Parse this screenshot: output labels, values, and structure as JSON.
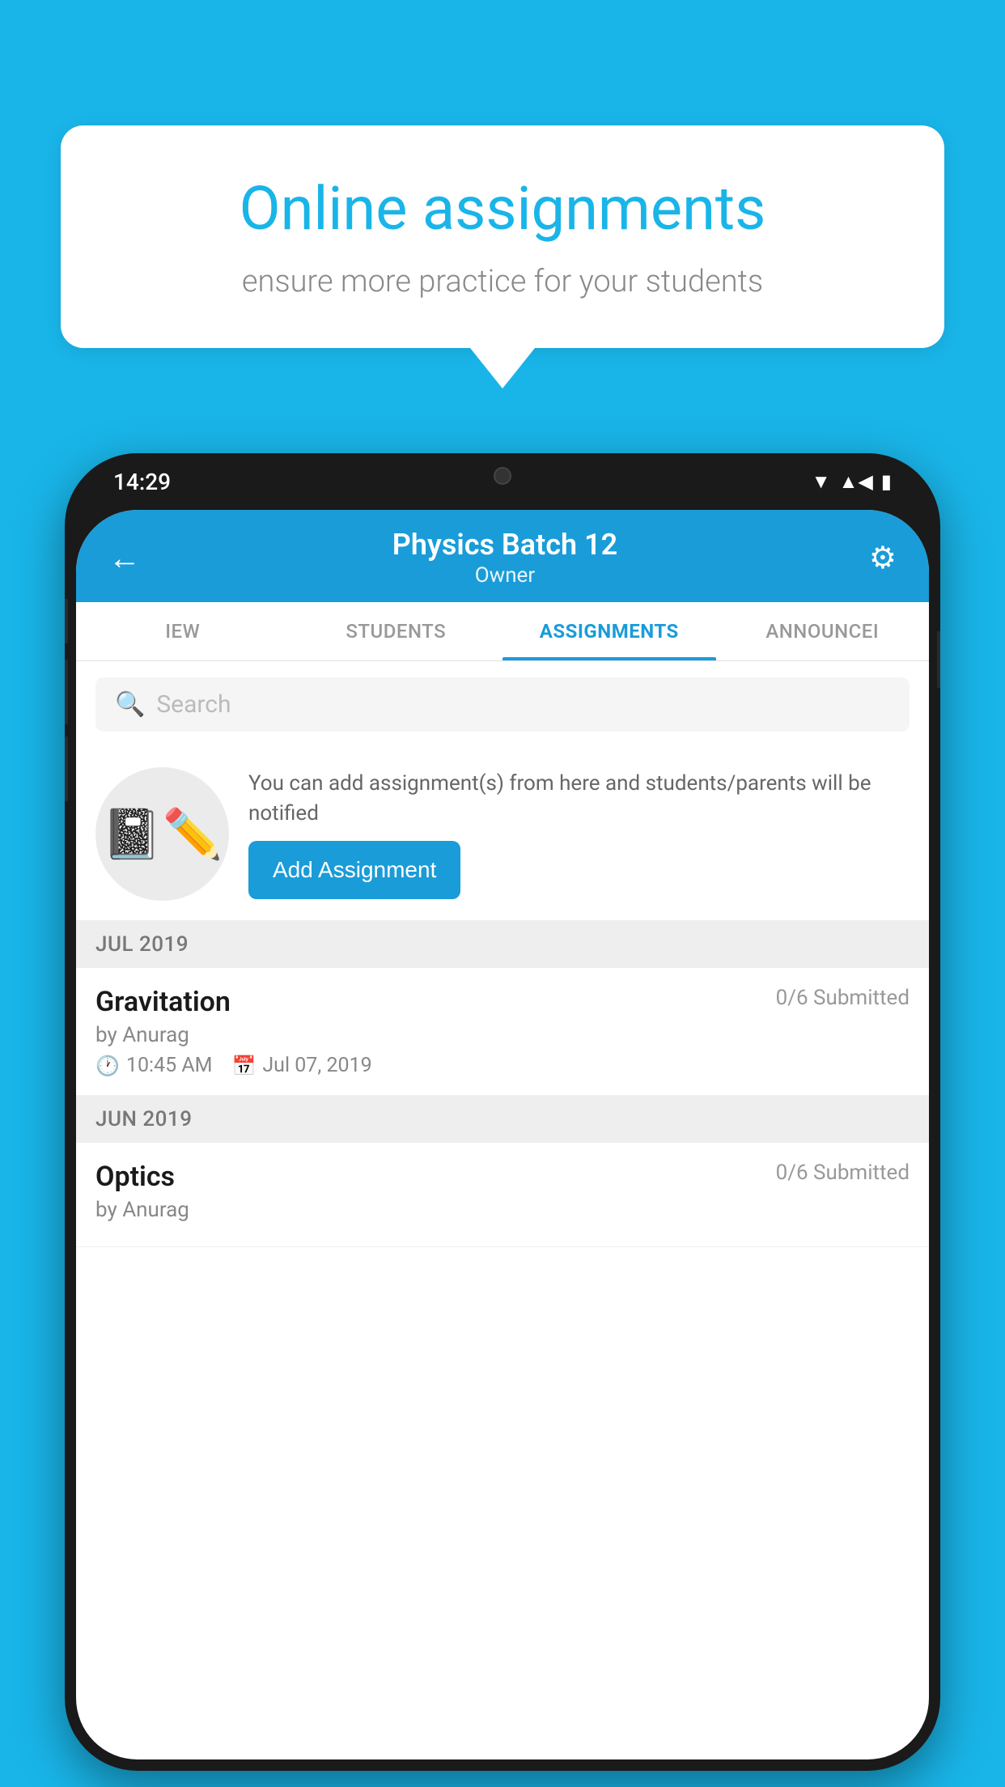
{
  "background": {
    "color": "#19b5e8"
  },
  "speech_bubble": {
    "title": "Online assignments",
    "subtitle": "ensure more practice for your students"
  },
  "phone": {
    "status_bar": {
      "time": "14:29"
    },
    "header": {
      "title": "Physics Batch 12",
      "subtitle": "Owner",
      "back_label": "←",
      "settings_label": "⚙"
    },
    "tabs": [
      {
        "label": "IEW",
        "active": false
      },
      {
        "label": "STUDENTS",
        "active": false
      },
      {
        "label": "ASSIGNMENTS",
        "active": true
      },
      {
        "label": "ANNOUNCEI",
        "active": false
      }
    ],
    "search": {
      "placeholder": "Search"
    },
    "promo": {
      "text": "You can add assignment(s) from here and students/parents will be notified",
      "button_label": "Add Assignment"
    },
    "sections": [
      {
        "header": "JUL 2019",
        "assignments": [
          {
            "name": "Gravitation",
            "submitted": "0/6 Submitted",
            "author": "by Anurag",
            "time": "10:45 AM",
            "date": "Jul 07, 2019"
          }
        ]
      },
      {
        "header": "JUN 2019",
        "assignments": [
          {
            "name": "Optics",
            "submitted": "0/6 Submitted",
            "author": "by Anurag",
            "time": "",
            "date": ""
          }
        ]
      }
    ]
  }
}
